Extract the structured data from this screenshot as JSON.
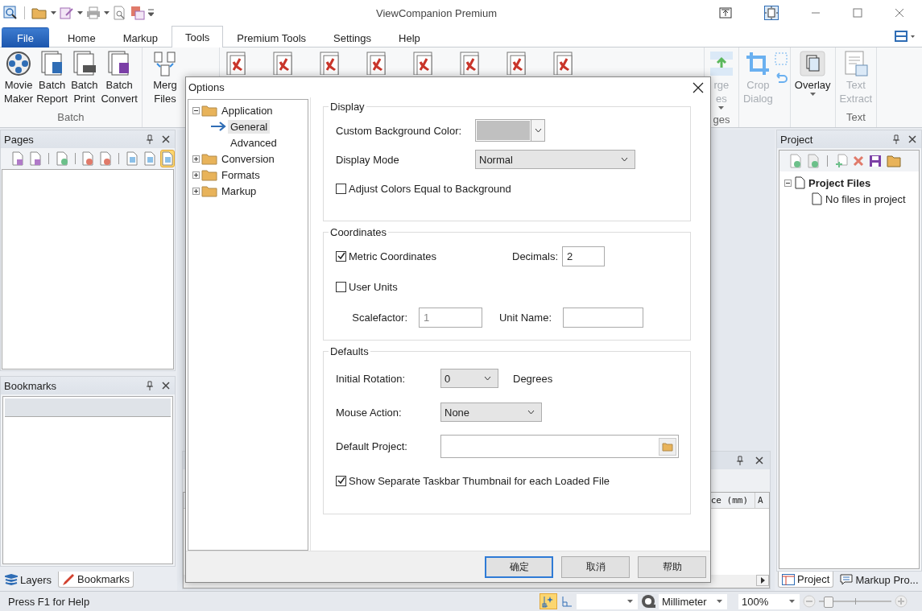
{
  "window": {
    "title": "ViewCompanion Premium"
  },
  "menu_tabs": [
    {
      "label": "File",
      "kind": "file",
      "selected": false
    },
    {
      "label": "Home",
      "kind": "tab",
      "selected": false
    },
    {
      "label": "Markup",
      "kind": "tab",
      "selected": false
    },
    {
      "label": "Tools",
      "kind": "tab",
      "selected": true
    },
    {
      "label": "Premium Tools",
      "kind": "tab",
      "selected": false
    },
    {
      "label": "Settings",
      "kind": "tab",
      "selected": false
    },
    {
      "label": "Help",
      "kind": "tab",
      "selected": false
    }
  ],
  "ribbon_left": [
    {
      "label": "Batch",
      "buttons": [
        {
          "lines": [
            "Movie",
            "Maker"
          ],
          "kind": "reel",
          "disabled": false
        },
        {
          "lines": [
            "Batch",
            "Report"
          ],
          "kind": "report",
          "disabled": false
        },
        {
          "lines": [
            "Batch",
            "Print"
          ],
          "kind": "print",
          "disabled": false
        },
        {
          "lines": [
            "Batch",
            "Convert"
          ],
          "kind": "convert",
          "disabled": false
        }
      ]
    },
    {
      "buttons": [
        {
          "lines": [
            "Merg",
            "Files"
          ],
          "kind": "merge",
          "disabled": false
        }
      ]
    }
  ],
  "ribbon_right": [
    {
      "label": "ges",
      "buttons": [
        {
          "lines": [
            "rge",
            "es"
          ],
          "kind": "rows",
          "disabled": true,
          "dropdown": true
        }
      ]
    },
    {
      "buttons": [
        {
          "lines": [
            "Crop",
            "Dialog"
          ],
          "kind": "crop",
          "disabled": true,
          "dropdown": false
        }
      ]
    },
    {
      "buttons": [
        {
          "lines": [
            "Overlay"
          ],
          "kind": "overlay",
          "disabled": false,
          "dropdown": true
        }
      ]
    },
    {
      "label": "Text",
      "buttons": [
        {
          "lines": [
            "Text",
            "Extract"
          ],
          "kind": "text",
          "disabled": true,
          "dropdown": false
        }
      ]
    }
  ],
  "pages_panel": {
    "title": "Pages",
    "toolbar": [
      {
        "pressed": false
      },
      {
        "pressed": false
      },
      {
        "pressed": false
      },
      {
        "pressed": false
      },
      {
        "pressed": false
      },
      {
        "pressed": false
      },
      {
        "pressed": false
      },
      {
        "pressed": true
      }
    ]
  },
  "bookmarks_panel": {
    "title": "Bookmarks"
  },
  "left_tabs": [
    {
      "label": "Layers",
      "kind": "layers",
      "selected": false
    },
    {
      "label": "Bookmarks",
      "kind": "bookmark",
      "selected": true
    }
  ],
  "measure_panel": {
    "columns": [
      "ce (mm)",
      "A"
    ]
  },
  "project_panel": {
    "title": "Project",
    "tree": [
      {
        "label": "Project Files",
        "expanded": true,
        "children": [
          {
            "label": "No files in project"
          }
        ]
      }
    ]
  },
  "right_tabs": [
    {
      "label": "Project",
      "kind": "table",
      "selected": true
    },
    {
      "label": "Markup Pro...",
      "kind": "comment",
      "selected": false
    }
  ],
  "status_bar": {
    "message": "Press F1 for Help",
    "snap_pressed": true,
    "unit": "Millimeter",
    "zoom": "100%",
    "zoom_slider": {
      "level": 0.12
    }
  },
  "dialog": {
    "title": "Options",
    "tree": [
      {
        "label": "Application",
        "expanded": true,
        "selected": false,
        "children": [
          {
            "label": "General",
            "selected": true
          },
          {
            "label": "Advanced",
            "selected": false
          }
        ]
      },
      {
        "label": "Conversion",
        "expanded": false,
        "selected": false
      },
      {
        "label": "Formats",
        "expanded": false,
        "selected": false
      },
      {
        "label": "Markup",
        "expanded": false,
        "selected": false
      }
    ],
    "display": {
      "title": "Display",
      "background_label": "Custom Background Color:",
      "mode_label": "Display Mode",
      "mode": "Normal",
      "adjust_label": "Adjust Colors Equal to Background",
      "adjust_checked": false
    },
    "coordinates": {
      "title": "Coordinates",
      "metric_label": "Metric Coordinates",
      "metric_checked": true,
      "decimals_label": "Decimals:",
      "decimals": "2",
      "user_units_label": "User Units",
      "user_units_checked": false,
      "scalefactor_label": "Scalefactor:",
      "scalefactor": "1",
      "unit_name_label": "Unit Name:"
    },
    "defaults": {
      "title": "Defaults",
      "rotation_label": "Initial Rotation:",
      "rotation": "0",
      "degrees_label": "Degrees",
      "mouse_label": "Mouse Action:",
      "mouse": "None",
      "project_label": "Default Project:",
      "taskbar_label": "Show Separate Taskbar Thumbnail for each Loaded File",
      "taskbar_checked": true
    },
    "buttons": [
      {
        "label": "确定",
        "default": true
      },
      {
        "label": "取消",
        "default": false
      },
      {
        "label": "帮助",
        "default": false
      }
    ]
  }
}
